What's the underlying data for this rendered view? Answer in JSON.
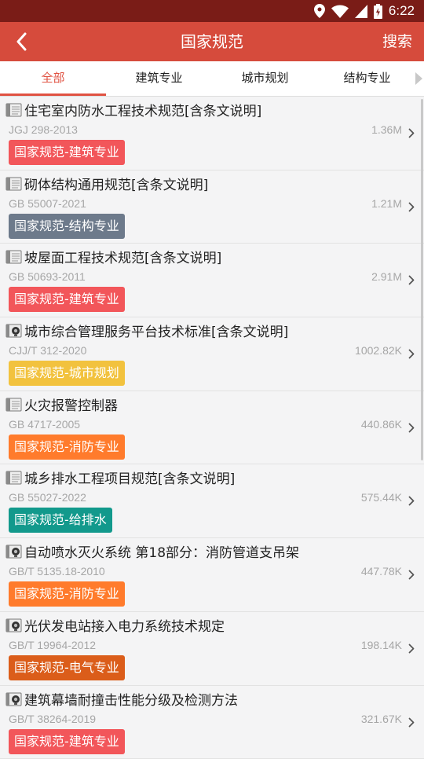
{
  "status_bar": {
    "time": "6:22",
    "icons": [
      "location-icon",
      "wifi-icon",
      "signal-icon",
      "battery-icon"
    ]
  },
  "header": {
    "title": "国家规范",
    "search_label": "搜索",
    "back_icon": "chevron-left-icon"
  },
  "tabs": [
    {
      "label": "全部",
      "active": true
    },
    {
      "label": "建筑专业",
      "active": false
    },
    {
      "label": "城市规划",
      "active": false
    },
    {
      "label": "结构专业",
      "active": false
    }
  ],
  "colors": {
    "accent": "#e05242",
    "appbar": "#d64b3c",
    "status_bar": "#7a1c17",
    "tag_architecture": "#f2565a",
    "tag_structure": "#6d7a8b",
    "tag_urban": "#f2c23e",
    "tag_fire": "#ff7b2c",
    "tag_water": "#12998c",
    "tag_electrical": "#db5d1a"
  },
  "items": [
    {
      "name": "住宅室内防水工程技术规范[含条文说明]",
      "code": "JGJ 298-2013",
      "size": "1.36M",
      "tag": "国家规范-建筑专业",
      "tag_color": "#f2565a",
      "icon": "document-icon"
    },
    {
      "name": "砌体结构通用规范[含条文说明]",
      "code": "GB 55007-2021",
      "size": "1.21M",
      "tag": "国家规范-结构专业",
      "tag_color": "#6d7a8b",
      "icon": "document-icon"
    },
    {
      "name": "坡屋面工程技术规范[含条文说明]",
      "code": "GB 50693-2011",
      "size": "2.91M",
      "tag": "国家规范-建筑专业",
      "tag_color": "#f2565a",
      "icon": "document-icon"
    },
    {
      "name": "城市综合管理服务平台技术标准[含条文说明]",
      "code": "CJJ/T 312-2020",
      "size": "1002.82K",
      "tag": "国家规范-城市规划",
      "tag_color": "#f2c23e",
      "icon": "pdf-viewer-icon"
    },
    {
      "name": "火灾报警控制器",
      "code": "GB 4717-2005",
      "size": "440.86K",
      "tag": "国家规范-消防专业",
      "tag_color": "#ff7b2c",
      "icon": "document-icon"
    },
    {
      "name": "城乡排水工程项目规范[含条文说明]",
      "code": "GB 55027-2022",
      "size": "575.44K",
      "tag": "国家规范-给排水",
      "tag_color": "#12998c",
      "icon": "document-icon"
    },
    {
      "name": "自动喷水灭火系统 第18部分：消防管道支吊架",
      "code": "GB/T 5135.18-2010",
      "size": "447.78K",
      "tag": "国家规范-消防专业",
      "tag_color": "#ff7b2c",
      "icon": "pdf-viewer-icon"
    },
    {
      "name": "光伏发电站接入电力系统技术规定",
      "code": "GB/T 19964-2012",
      "size": "198.14K",
      "tag": "国家规范-电气专业",
      "tag_color": "#db5d1a",
      "icon": "pdf-viewer-icon"
    },
    {
      "name": "建筑幕墙耐撞击性能分级及检测方法",
      "code": "GB/T 38264-2019",
      "size": "321.67K",
      "tag": "国家规范-建筑专业",
      "tag_color": "#f2565a",
      "icon": "pdf-viewer-icon"
    }
  ]
}
